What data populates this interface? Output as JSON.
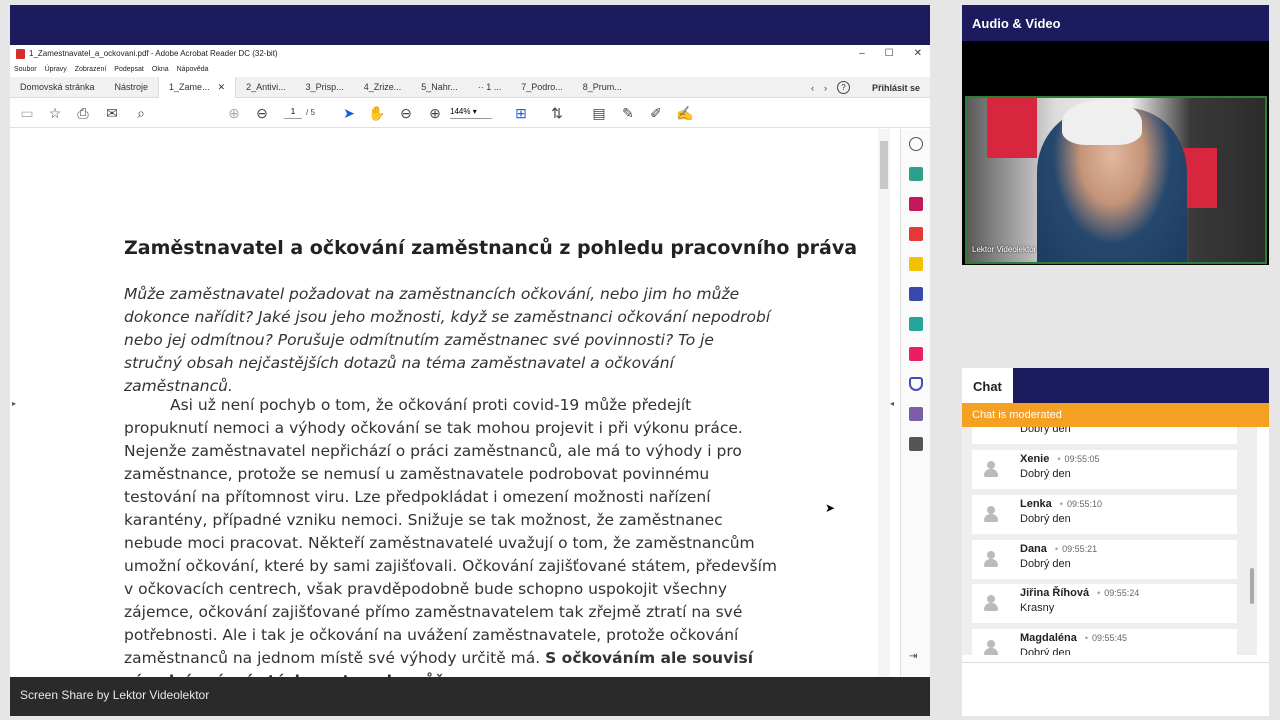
{
  "acrobat": {
    "window_title": "1_Zamestnavatel_a_ockovani.pdf - Adobe Acrobat Reader DC (32-bit)",
    "window_controls": [
      "–",
      "☐",
      "✕"
    ],
    "menu": [
      "Soubor",
      "Úpravy",
      "Zobrazení",
      "Podepsat",
      "Okna",
      "Nápověda"
    ],
    "tabs": [
      "Domovská stránka",
      "Nástroje",
      "1_Zame...",
      "2_Antivi...",
      "3_Prisp...",
      "4_Zrize...",
      "5_Nahr...",
      "·· 1 ...",
      "7_Podro...",
      "8_Prum..."
    ],
    "tab_close": "✕",
    "nav_prev": "‹",
    "nav_next": "›",
    "help_label": "?",
    "signin_label": "Přihlásit se",
    "page_current": "1",
    "page_total": "/ 5",
    "zoom": "144%"
  },
  "document": {
    "title": "Zaměstnavatel a očkování zaměstnanců z pohledu pracovního práva",
    "lead": "Může zaměstnavatel požadovat na zaměstnancích očkování, nebo jim ho může dokonce nařídit? Jaké jsou jeho možnosti, když se zaměstnanci očkování nepodrobí nebo jej odmítnou? Porušuje odmítnutím zaměstnanec své povinnosti? To je stručný obsah nejčastějších dotazů na téma zaměstnavatel a očkování zaměstnanců.",
    "body": "Asi už není pochyb o tom, že očkování proti covid-19 může předejít propuknutí nemoci a výhody očkování se tak mohou projevit i při výkonu práce. Nejenže zaměstnavatel nepřichází o práci zaměstnanců, ale má to výhody i pro zaměstnance, protože se nemusí u zaměstnavatele podrobovat povinnému testování na přítomnost viru. Lze předpokládat i omezení možnosti nařízení karantény, případné vzniku nemoci. Snižuje se tak možnost, že zaměstnanec nebude moci pracovat. Někteří zaměstnavatelé uvažují o tom, že zaměstnancům umožní očkování, které by sami zajišťovali. Očkování zajišťované státem, především v očkovacích centrech, však pravděpodobně bude schopno uspokojit všechny zájemce, očkování zajišťované přímo zaměstnavatelem tak zřejmě ztratí na své potřebnosti. Ale i tak je očkování na uvážení zaměstnavatele, protože očkování zaměstnanců na jednom místě své výhody určitě má. ",
    "body_bold": "S očkováním ale souvisí zásadní právní otázka, a to, zda může"
  },
  "share": {
    "footer": "Screen Share by Lektor Videolektor"
  },
  "av": {
    "header": "Audio & Video",
    "video_label": "Lektor Videolektor"
  },
  "chat": {
    "tab": "Chat",
    "moderated": "Chat is moderated",
    "messages": [
      {
        "name": "",
        "time": "",
        "text": "Dobrý den"
      },
      {
        "name": "Xenie",
        "time": "09:55:05",
        "text": "Dobrý den"
      },
      {
        "name": "Lenka",
        "time": "09:55:10",
        "text": "Dobrý den"
      },
      {
        "name": "Dana",
        "time": "09:55:21",
        "text": "Dobrý den"
      },
      {
        "name": "Jiřina Říhová",
        "time": "09:55:24",
        "text": "Krasny"
      },
      {
        "name": "Magdaléna",
        "time": "09:55:45",
        "text": "Dobrý den"
      }
    ]
  },
  "colors": {
    "bbb_navy": "#1b1b5e",
    "moderated_orange": "#f4a022",
    "video_border_green": "#2e7d32"
  },
  "icons": {
    "toolbar": [
      "save-icon",
      "star-icon",
      "print-icon",
      "email-icon",
      "search-icon",
      "page-up-icon",
      "page-down-icon",
      "select-arrow-icon",
      "hand-icon",
      "zoom-out-icon",
      "zoom-in-icon",
      "fit-page-icon",
      "scroll-mode-icon",
      "comment-icon",
      "highlight-icon",
      "draw-icon",
      "sign-icon"
    ],
    "rail": [
      "zoom-icon",
      "export-pdf-icon",
      "organize-icon",
      "create-pdf-icon",
      "comment-icon",
      "combine-icon",
      "scan-icon",
      "fill-sign-icon",
      "protect-icon",
      "request-signature-icon",
      "more-tools-icon"
    ]
  }
}
